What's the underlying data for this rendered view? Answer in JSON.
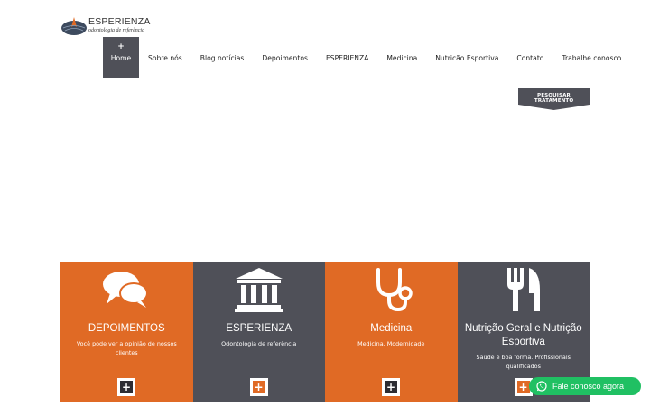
{
  "brand": {
    "name": "ESPERIENZA",
    "tagline": "odontologia de referência",
    "colors": {
      "orange": "#e06a25",
      "dark": "#4f5058",
      "whatsapp": "#20c063"
    }
  },
  "nav": {
    "active_marker": "+",
    "items": [
      {
        "label": "Home"
      },
      {
        "label": "Sobre nós"
      },
      {
        "label": "Blog notícias"
      },
      {
        "label": "Depoimentos"
      },
      {
        "label": "ESPERIENZA"
      },
      {
        "label": "Medicina"
      },
      {
        "label": "Nutricão Esportiva"
      },
      {
        "label": "Contato"
      },
      {
        "label": "Trabalhe conosco"
      }
    ]
  },
  "search": {
    "label": "PESQUISAR TRATAMENTO"
  },
  "cards": [
    {
      "icon": "speech-bubbles-icon",
      "title": "DEPOIMENTOS",
      "desc": "Você pode ver a opinião de nossos clientes",
      "button": "+"
    },
    {
      "icon": "building-columns-icon",
      "title": "ESPERIENZA",
      "desc": "Odontologia de referência",
      "button": "+"
    },
    {
      "icon": "stethoscope-icon",
      "title": "Medicina",
      "desc": "Medicina. Modernidade",
      "button": "+"
    },
    {
      "icon": "fork-knife-icon",
      "title": "Nutrição Geral e Nutrição Esportiva",
      "desc": "Saúde e boa forma. Profissionais qualificados",
      "button": "+"
    }
  ],
  "whatsapp": {
    "icon": "whatsapp-icon",
    "label": "Fale conosco agora"
  }
}
